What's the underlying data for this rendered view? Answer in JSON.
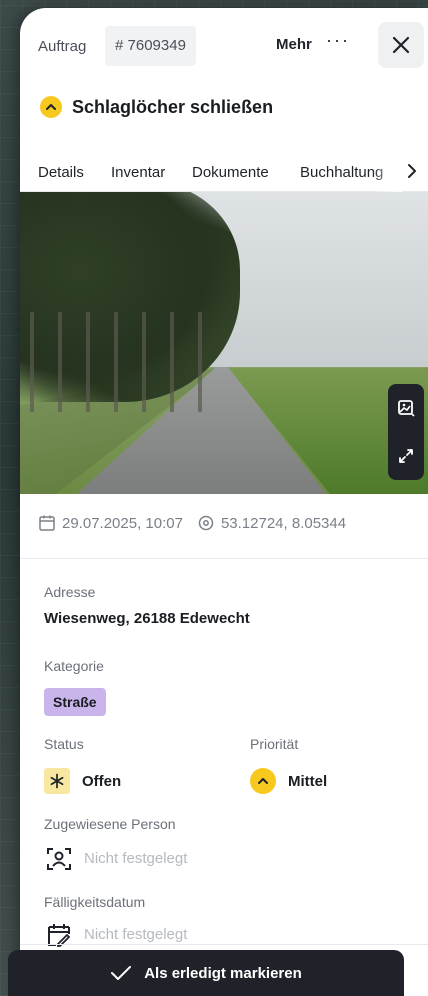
{
  "header": {
    "order_label": "Auftrag",
    "order_id": "# 7609349",
    "more_label": "Mehr",
    "more_icon": "ellipsis-icon",
    "close_icon": "close-icon"
  },
  "task": {
    "title": "Schlaglöcher schließen",
    "priority_icon": "chevron-up-icon",
    "priority_color": "#f7c81e"
  },
  "tabs": [
    {
      "label": "Details",
      "active": true
    },
    {
      "label": "Inventar",
      "active": false
    },
    {
      "label": "Dokumente",
      "active": false
    },
    {
      "label": "Buchhaltung",
      "active": false
    }
  ],
  "photo": {
    "gallery_icon": "image-gallery-icon",
    "expand_icon": "expand-icon"
  },
  "meta": {
    "datetime": "29.07.2025, 10:07",
    "coordinates": "53.12724, 8.05344"
  },
  "details": {
    "address_label": "Adresse",
    "address_value": "Wiesenweg, 26188 Edewecht",
    "category_label": "Kategorie",
    "category_value": "Straße",
    "category_color": "#c9b4ec",
    "status_label": "Status",
    "status_value": "Offen",
    "priority_label": "Priorität",
    "priority_value": "Mittel",
    "assignee_label": "Zugewiesene Person",
    "assignee_value": "Nicht festgelegt",
    "due_label": "Fälligkeitsdatum",
    "due_value": "Nicht festgelegt"
  },
  "footer": {
    "complete_label": "Als erledigt markieren"
  }
}
